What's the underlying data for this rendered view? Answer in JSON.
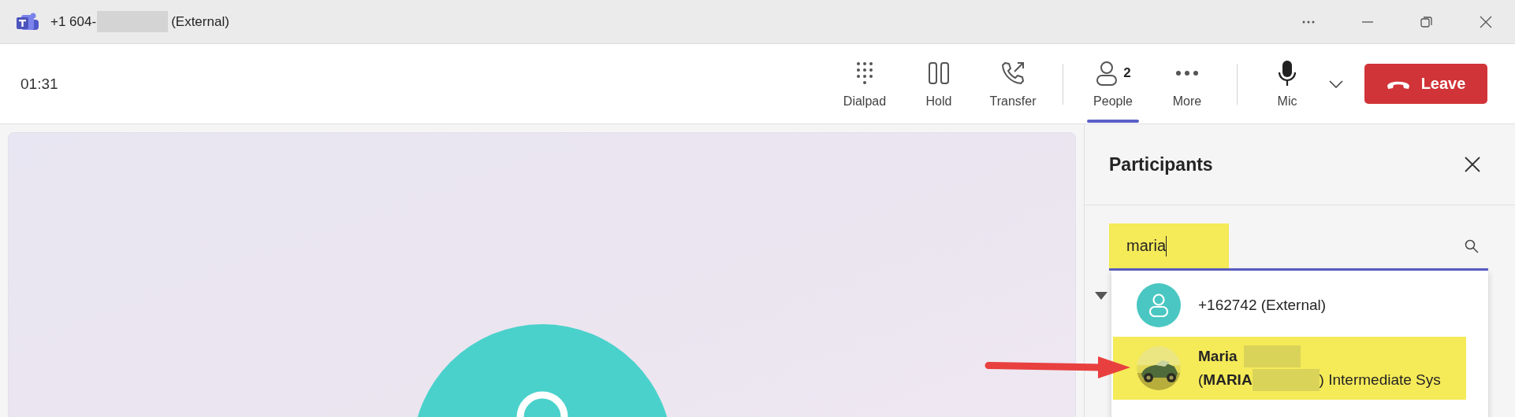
{
  "window": {
    "title_start": "+1 604-",
    "title_redacted": true,
    "title_end": "(External)"
  },
  "call": {
    "timer": "01:31"
  },
  "toolbar": [
    {
      "kind": "dialpad",
      "label": "Dialpad",
      "selected": false
    },
    {
      "kind": "hold",
      "label": "Hold",
      "selected": false
    },
    {
      "kind": "transfer",
      "label": "Transfer",
      "selected": false
    },
    {
      "kind": "separator"
    },
    {
      "kind": "people",
      "label": "People",
      "count": "2",
      "selected": true
    },
    {
      "kind": "more",
      "label": "More",
      "selected": false
    },
    {
      "kind": "separator"
    },
    {
      "kind": "mic",
      "label": "Mic",
      "selected": false
    },
    {
      "kind": "chevron"
    }
  ],
  "leave_button": {
    "label": "Leave"
  },
  "participants_panel": {
    "title": "Participants",
    "search": {
      "value": "maria",
      "highlighted": true
    },
    "results": [
      {
        "kind": "person",
        "name": "+162742 (External)",
        "highlighted": false
      },
      {
        "kind": "picture",
        "name": "Maria",
        "name_redacted": true,
        "detail_start": "(**MARIA**",
        "detail_redacted": true,
        "detail_end": ") Intermediate Sys",
        "highlighted": true
      }
    ]
  },
  "annotation": {
    "arrow": true
  }
}
